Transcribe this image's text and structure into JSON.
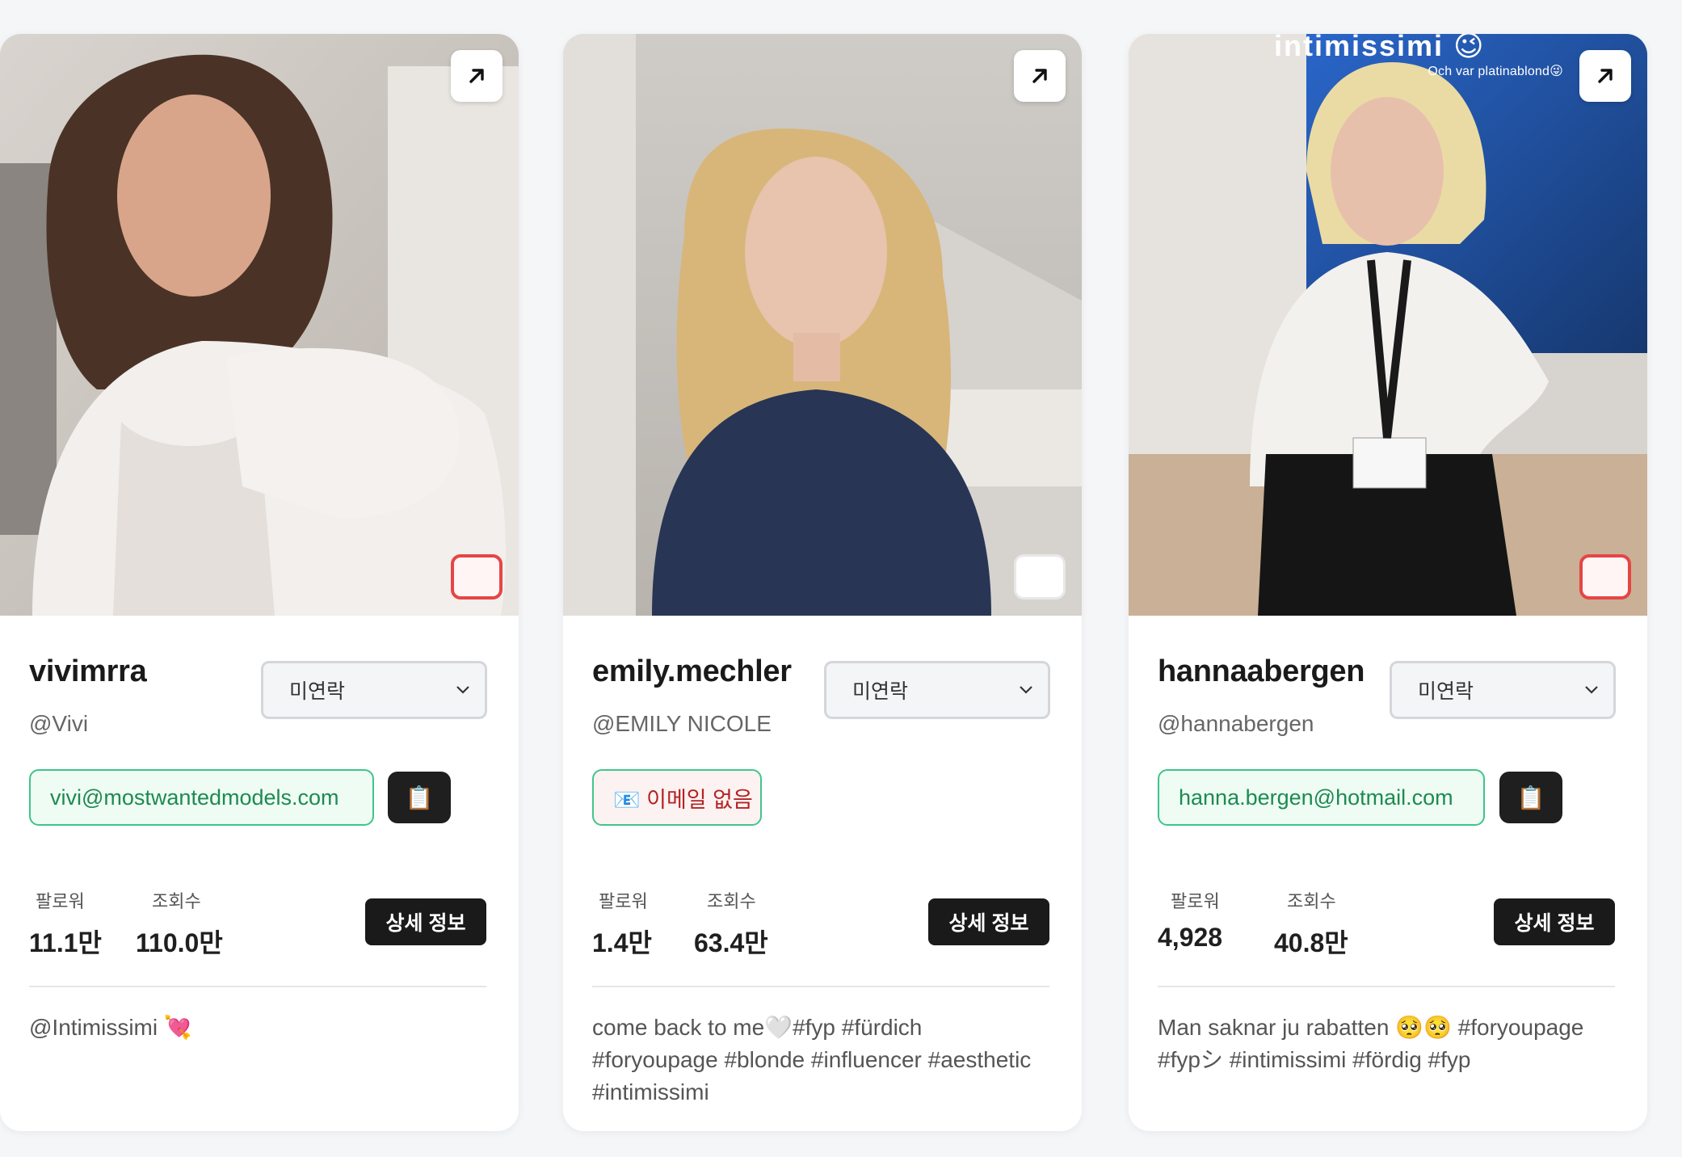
{
  "ui": {
    "status_default": "미연락",
    "followers_label": "팔로워",
    "views_label": "조회수",
    "detail_button": "상세 정보",
    "copy_icon_glyph": "📋"
  },
  "cards": [
    {
      "name": "vivimrra",
      "handle": "@Vivi",
      "status": "미연락",
      "email": "vivi@mostwantedmodels.com",
      "has_email": true,
      "followers": "11.1만",
      "views": "110.0만",
      "bio": "@Intimissimi 💘",
      "selected": true
    },
    {
      "name": "emily.mechler",
      "handle": "@EMILY NICOLE",
      "status": "미연락",
      "email": "📧 이메일 없음",
      "has_email": false,
      "followers": "1.4만",
      "views": "63.4만",
      "bio": "come back to me🤍#fyp #fürdich #foryoupage #blonde #influencer #aesthetic #intimissimi",
      "selected": false
    },
    {
      "name": "hannaabergen",
      "handle": "@hannabergen",
      "status": "미연락",
      "email": "hanna.bergen@hotmail.com",
      "has_email": true,
      "followers": "4,928",
      "views": "40.8만",
      "bio": "Man saknar ju rabatten 🥺🥺 #foryoupage #fypシ #intimissimi #fördig #fyp",
      "selected": true,
      "photo_overlay_text": "Och var platinablond😜",
      "photo_overlay_title": "intimissimi 😉"
    }
  ],
  "colors": {
    "email_border": "#3fc48a",
    "email_text": "#1e8a50",
    "no_email_text": "#b42323",
    "selected_border": "#e64545",
    "button_dark": "#1a1a1a"
  },
  "icons": {
    "open": "arrow-up-right-icon",
    "status": "chevron-down-icon",
    "copy": "clipboard-icon"
  }
}
